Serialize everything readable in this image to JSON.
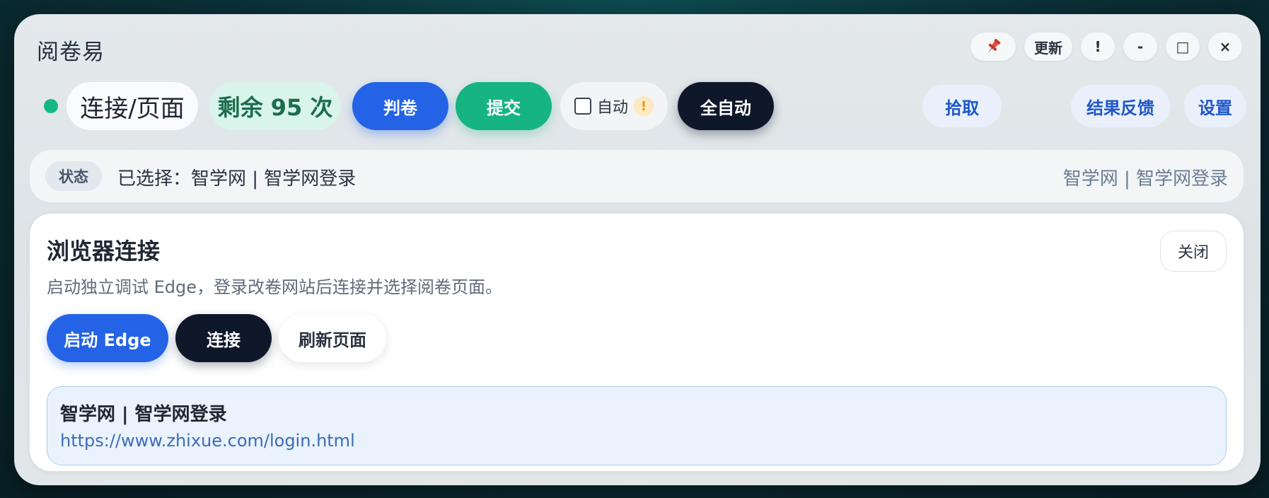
{
  "window": {
    "title": "阅卷易",
    "controls": {
      "pin_icon": "pushpin-icon",
      "update_label": "更新",
      "alert_label": "!",
      "minimize_label": "-",
      "maximize_label": "□",
      "close_label": "×"
    }
  },
  "toolbar": {
    "connection_status_color": "#14b886",
    "page_label": "连接/页面",
    "remaining_label": "剩余 95 次",
    "grade_label": "判卷",
    "submit_label": "提交",
    "auto_label": "自动",
    "auto_checked": false,
    "auto_warning": "!",
    "full_auto_label": "全自动",
    "pick_label": "拾取",
    "feedback_label": "结果反馈",
    "settings_label": "设置"
  },
  "status": {
    "badge": "状态",
    "text": "已选择：智学网 | 智学网登录",
    "right_text": "智学网 | 智学网登录"
  },
  "browser_panel": {
    "title": "浏览器连接",
    "description": "启动独立调试 Edge，登录改卷网站后连接并选择阅卷页面。",
    "close_label": "关闭",
    "launch_edge_label": "启动 Edge",
    "connect_label": "连接",
    "refresh_label": "刷新页面",
    "selected_page": {
      "title": "智学网 | 智学网登录",
      "url": "https://www.zhixue.com/login.html"
    }
  },
  "colors": {
    "primary_blue": "#2463e6",
    "success_green": "#16b482",
    "dark": "#0f172a"
  }
}
